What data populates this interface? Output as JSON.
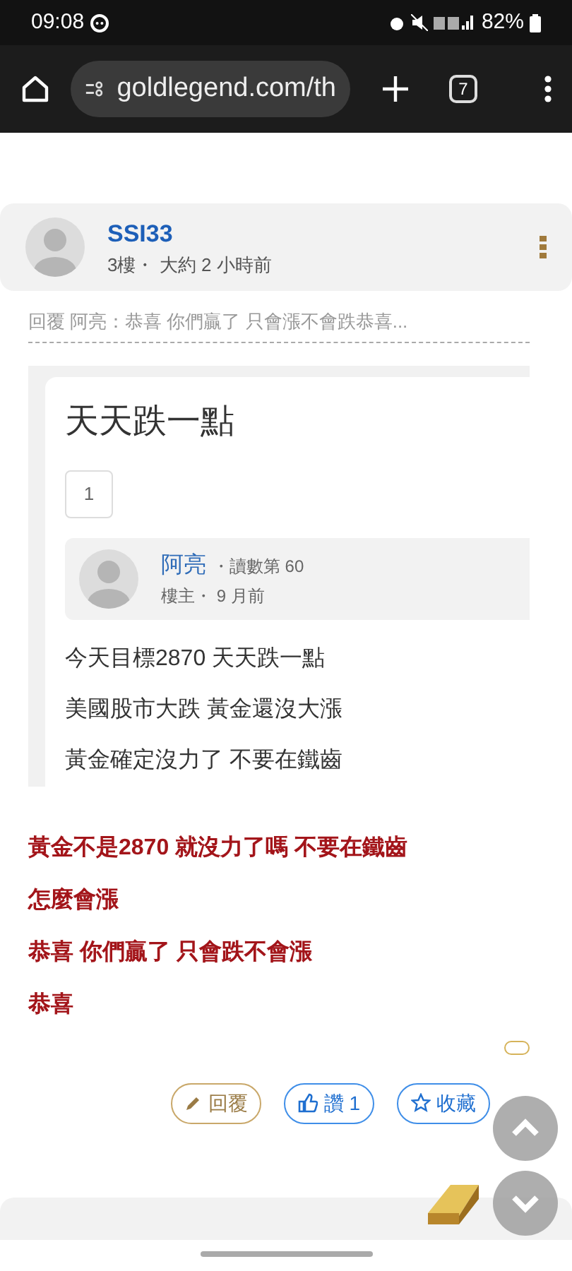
{
  "status_bar": {
    "time": "09:08",
    "battery": "82%"
  },
  "browser": {
    "url": "goldlegend.com/th",
    "tab_count": "7"
  },
  "post": {
    "author": "SSI33",
    "meta": "3樓・ 大約 2 小時前",
    "quote": "回覆 阿亮：恭喜 你們贏了 只會漲不會跌恭喜...",
    "embedded": {
      "title": "天天跌一點",
      "page": "1",
      "author": "阿亮",
      "rank": "・讀數第 60",
      "meta": "樓主・ 9 月前",
      "lines": [
        "今天目標2870 天天跌一點",
        "美國股市大跌 黃金還沒大漲",
        "黃金確定沒力了 不要在鐵齒"
      ]
    },
    "lines": [
      "黃金不是2870 就沒力了嗎 不要在鐵齒",
      "怎麼會漲",
      "恭喜 你們贏了 只會跌不會漲",
      "恭喜"
    ],
    "actions": [
      {
        "kind": "reply",
        "label": "回覆"
      },
      {
        "kind": "like",
        "label": "讚 1"
      },
      {
        "kind": "favorite",
        "label": "收藏"
      }
    ]
  }
}
